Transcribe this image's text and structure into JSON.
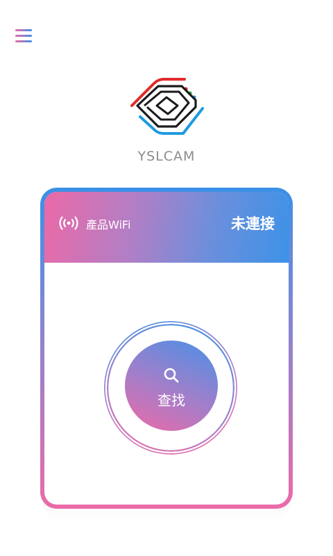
{
  "app": {
    "brand_name": "YSLCAM"
  },
  "header": {
    "menu_icon": "hamburger-menu-icon"
  },
  "wifi_card": {
    "wifi_icon": "wifi-signal-icon",
    "label": "產品WiFi",
    "status": "未連接"
  },
  "search": {
    "icon": "search-icon",
    "label": "查找"
  },
  "colors": {
    "pink": "#ee68a6",
    "blue": "#3a92e8",
    "brand_text": "#8b8b8b",
    "logo_red": "#e02a2a",
    "logo_blue": "#1e9be0",
    "logo_green": "#2bb24c"
  }
}
